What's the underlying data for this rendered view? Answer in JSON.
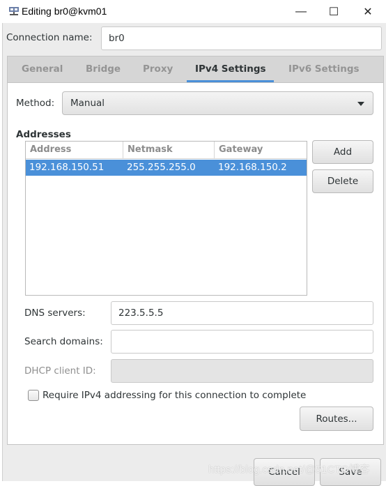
{
  "window": {
    "title": "Editing br0@kvm01",
    "icon": "network-icon",
    "controls": {
      "minimize": "—",
      "maximize": "☐",
      "close": "✕"
    }
  },
  "connection": {
    "label": "Connection name:",
    "value": "br0"
  },
  "tabs": [
    {
      "label": "General"
    },
    {
      "label": "Bridge"
    },
    {
      "label": "Proxy"
    },
    {
      "label": "IPv4 Settings",
      "active": true
    },
    {
      "label": "IPv6 Settings"
    }
  ],
  "ipv4": {
    "method_label": "Method:",
    "method_value": "Manual",
    "addresses_heading": "Addresses",
    "columns": [
      "Address",
      "Netmask",
      "Gateway"
    ],
    "rows": [
      {
        "address": "192.168.150.51",
        "netmask": "255.255.255.0",
        "gateway": "192.168.150.2",
        "selected": true
      }
    ],
    "add_label": "Add",
    "delete_label": "Delete",
    "dns_label": "DNS servers:",
    "dns_value": "223.5.5.5",
    "search_label": "Search domains:",
    "search_value": "",
    "dhcp_label": "DHCP client ID:",
    "dhcp_value": "",
    "require_label": "Require IPv4 addressing for this connection to complete",
    "require_checked": false,
    "routes_label": "Routes..."
  },
  "footer": {
    "cancel_label": "Cancel",
    "save_label": "Save"
  },
  "watermark": "https://blog.csdn.net/@51CTO博客",
  "colors": {
    "accent": "#4a90d9",
    "selection": "#4a90d9"
  }
}
